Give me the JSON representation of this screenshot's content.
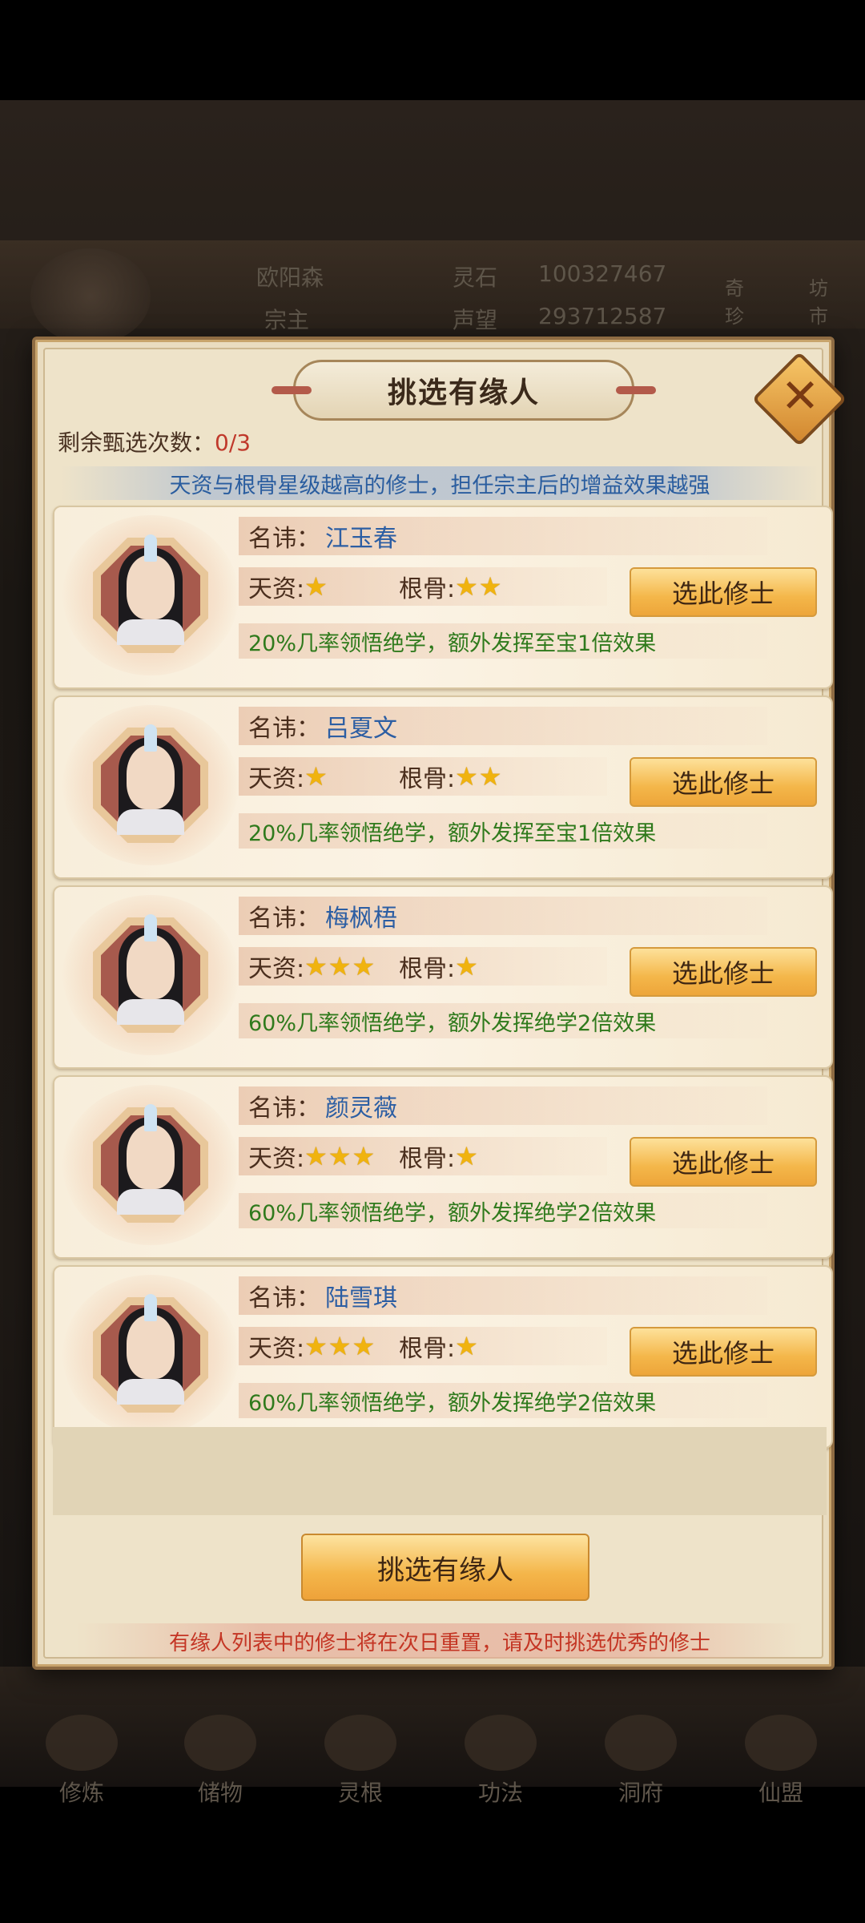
{
  "background": {
    "player_name": "欧阳森",
    "rank": "宗主",
    "lingshi_label": "灵石",
    "lingshi_value": "100327467",
    "shengwang_label": "声望",
    "shengwang_value": "293712587",
    "side_label_1": "奇珍",
    "side_label_2": "坊市",
    "nav": [
      "修炼",
      "储物",
      "灵根",
      "功法",
      "洞府",
      "仙盟"
    ]
  },
  "dialog": {
    "title": "挑选有缘人",
    "remaining_label": "剩余甄选次数：",
    "remaining_value": "0/3",
    "tip": "天资与根骨星级越高的修士，担任宗主后的增益效果越强",
    "name_label": "名讳：",
    "talent_label": "天资:",
    "bone_label": "根骨:",
    "select_label": "选此修士",
    "main_button": "挑选有缘人",
    "footer": "有缘人列表中的修士将在次日重置，请及时挑选优秀的修士"
  },
  "candidates": [
    {
      "name": "江玉春",
      "talent_stars": 1,
      "bone_stars": 2,
      "talent": "★",
      "bone": "★★",
      "effect": "20%几率领悟绝学，额外发挥至宝1倍效果"
    },
    {
      "name": "吕夏文",
      "talent_stars": 1,
      "bone_stars": 2,
      "talent": "★",
      "bone": "★★",
      "effect": "20%几率领悟绝学，额外发挥至宝1倍效果"
    },
    {
      "name": "梅枫梧",
      "talent_stars": 3,
      "bone_stars": 1,
      "talent": "★★★",
      "bone": "★",
      "effect": "60%几率领悟绝学，额外发挥绝学2倍效果"
    },
    {
      "name": "颜灵薇",
      "talent_stars": 3,
      "bone_stars": 1,
      "talent": "★★★",
      "bone": "★",
      "effect": "60%几率领悟绝学，额外发挥绝学2倍效果"
    },
    {
      "name": "陆雪琪",
      "talent_stars": 3,
      "bone_stars": 1,
      "talent": "★★★",
      "bone": "★",
      "effect": "60%几率领悟绝学，额外发挥绝学2倍效果"
    }
  ],
  "colors": {
    "name_blue": "#2c5ea3",
    "effect_green": "#2f7a1c",
    "warning_red": "#c43524",
    "star_gold": "#f0b30f"
  }
}
